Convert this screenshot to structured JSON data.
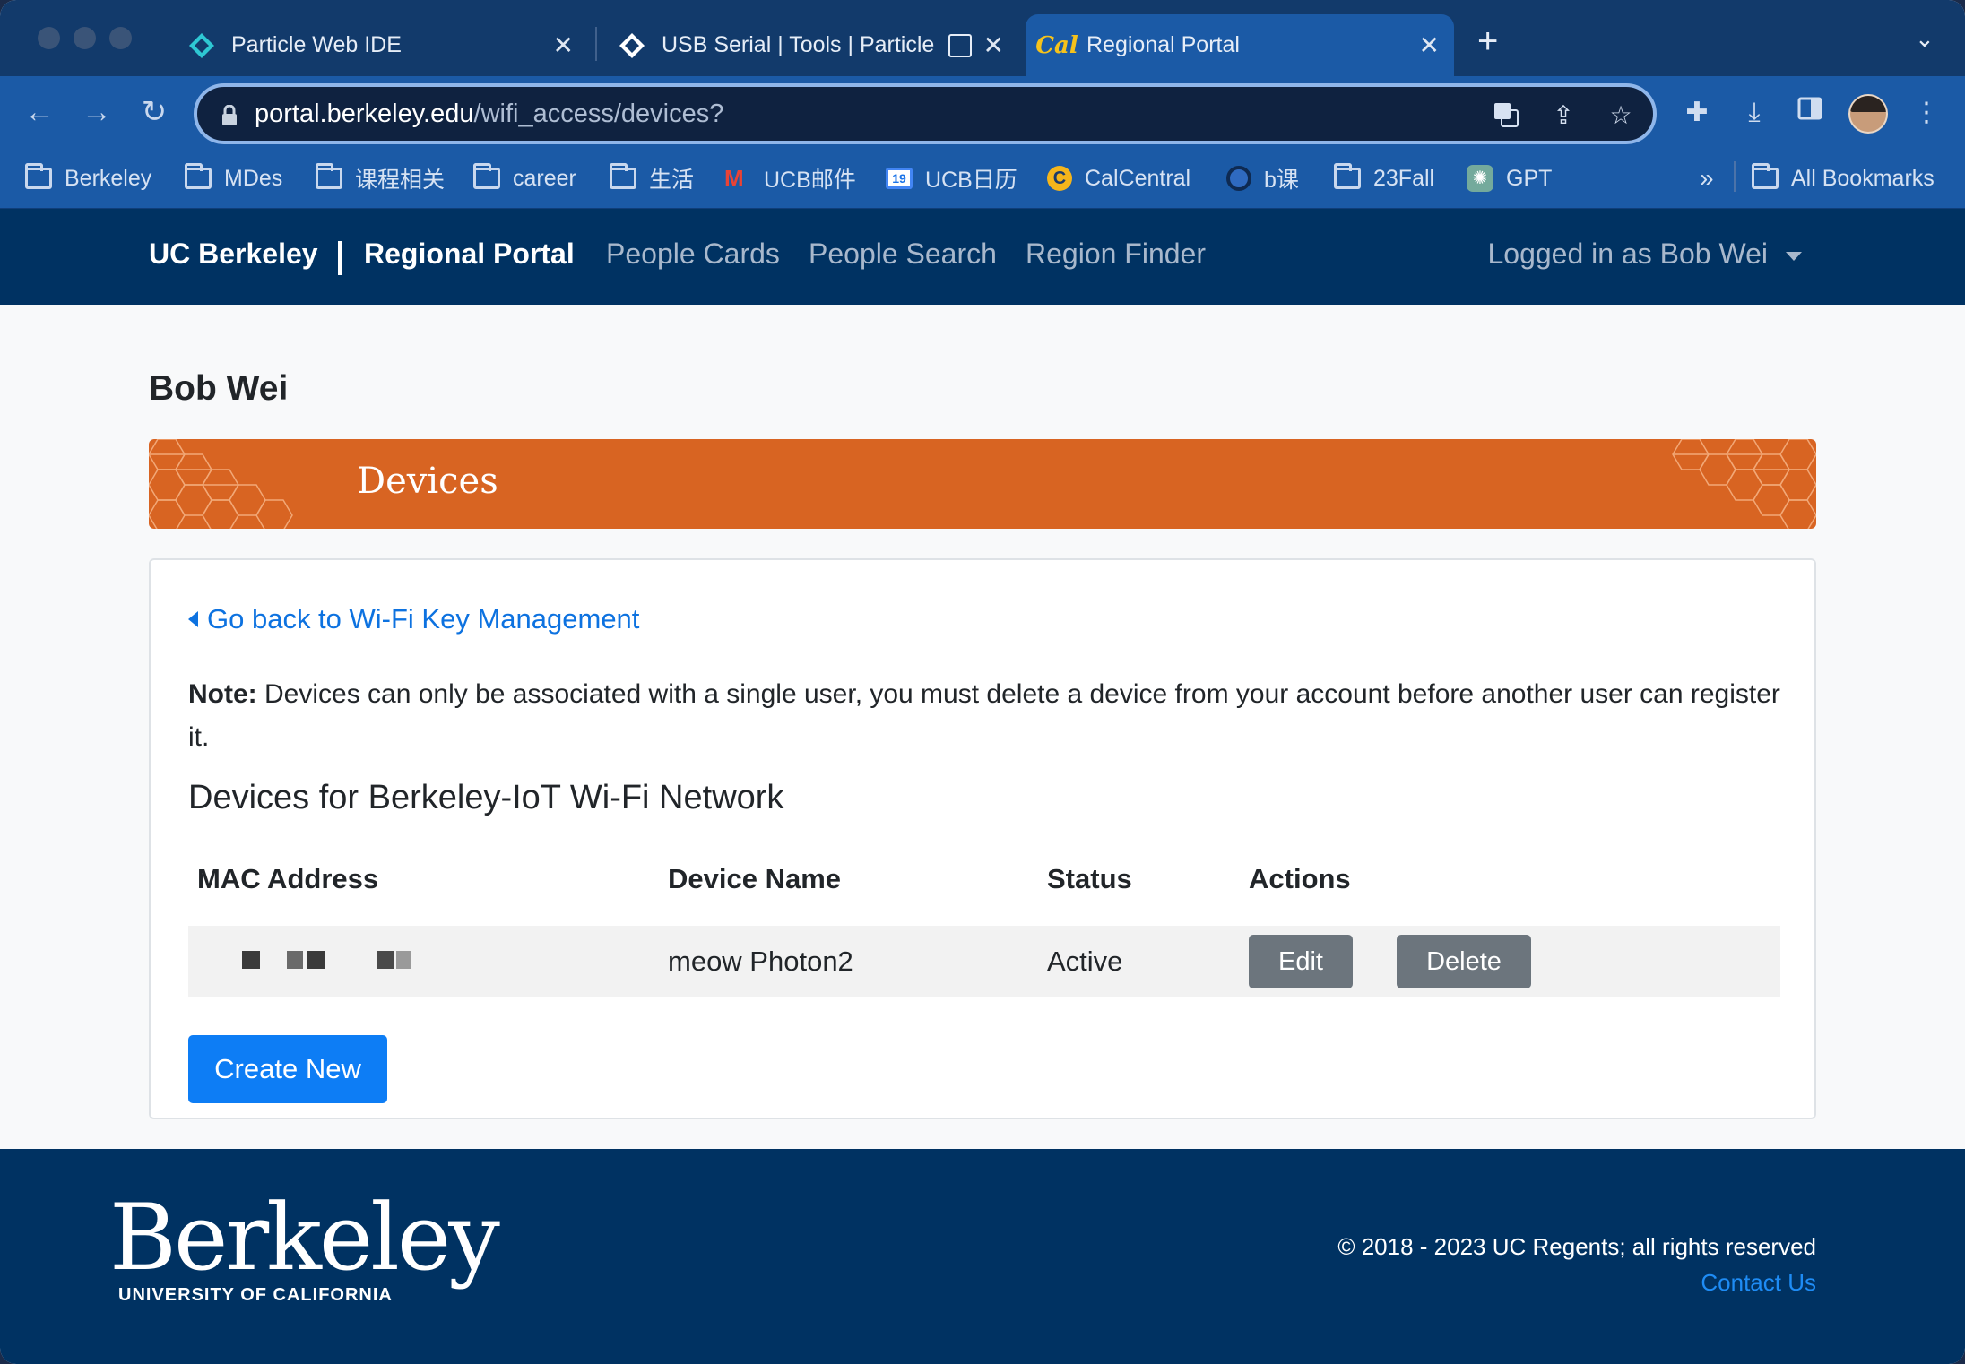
{
  "browser": {
    "tabs": [
      {
        "title": "Particle Web IDE",
        "active": false
      },
      {
        "title": "USB Serial | Tools | Particle",
        "active": false
      },
      {
        "title": "Regional Portal",
        "active": true
      }
    ],
    "url_host": "portal.berkeley.edu",
    "url_path": "/wifi_access/devices?",
    "bookmarks": [
      "Berkeley",
      "MDes",
      "课程相关",
      "career",
      "生活",
      "UCB邮件",
      "UCB日历",
      "CalCentral",
      "b课",
      "23Fall",
      "GPT"
    ],
    "bookmarks_overflow": "»",
    "all_bookmarks": "All Bookmarks"
  },
  "navbar": {
    "brand_left": "UC Berkeley",
    "brand_right": "Regional Portal",
    "links": [
      "People Cards",
      "People Search",
      "Region Finder"
    ],
    "user_label": "Logged in as Bob Wei"
  },
  "page": {
    "user_name": "Bob Wei",
    "banner_title": "Devices",
    "back_link": "Go back to Wi-Fi Key Management",
    "note_label": "Note:",
    "note_text": " Devices can only be associated with a single user, you must delete a device from your account before another user can register it.",
    "subheading": "Devices for Berkeley-IoT Wi-Fi Network",
    "table": {
      "headers": [
        "MAC Address",
        "Device Name",
        "Status",
        "Actions"
      ],
      "rows": [
        {
          "device_name": "meow Photon2",
          "status": "Active",
          "edit": "Edit",
          "delete": "Delete"
        }
      ]
    },
    "create_button": "Create New"
  },
  "footer": {
    "logo_word": "Berkeley",
    "logo_sub": "UNIVERSITY OF CALIFORNIA",
    "copyright": "© 2018 - 2023 UC Regents; all rights reserved",
    "contact": "Contact Us"
  },
  "colors": {
    "navy": "#003262",
    "orange": "#d86422",
    "primary": "#0d7df5",
    "secondary": "#6c757d",
    "link": "#0d72e0"
  }
}
